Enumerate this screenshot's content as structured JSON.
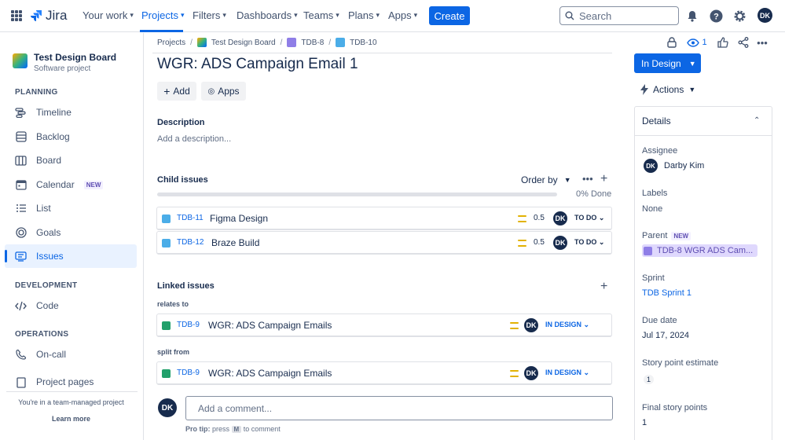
{
  "topnav": {
    "logo_text": "Jira",
    "items": [
      {
        "label": "Your work"
      },
      {
        "label": "Projects"
      },
      {
        "label": "Filters"
      },
      {
        "label": "Dashboards"
      },
      {
        "label": "Teams"
      },
      {
        "label": "Plans"
      },
      {
        "label": "Apps"
      }
    ],
    "create_label": "Create",
    "search_placeholder": "Search",
    "avatar_initials": "DK"
  },
  "sidebar": {
    "project_name": "Test Design Board",
    "project_type": "Software project",
    "planning_heading": "PLANNING",
    "planning_items": [
      {
        "label": "Timeline",
        "icon": "timeline-icon"
      },
      {
        "label": "Backlog",
        "icon": "backlog-icon"
      },
      {
        "label": "Board",
        "icon": "board-icon"
      },
      {
        "label": "Calendar",
        "icon": "calendar-icon",
        "badge": "NEW"
      },
      {
        "label": "List",
        "icon": "list-icon"
      },
      {
        "label": "Goals",
        "icon": "goals-icon"
      },
      {
        "label": "Issues",
        "icon": "issues-icon",
        "active": true
      }
    ],
    "development_heading": "DEVELOPMENT",
    "code_label": "Code",
    "operations_heading": "OPERATIONS",
    "oncall_label": "On-call",
    "project_pages_label": "Project pages",
    "team_managed_text": "You're in a team-managed project",
    "learn_more": "Learn more"
  },
  "breadcrumb": {
    "projects": "Projects",
    "project": "Test Design Board",
    "parent": "TDB-8",
    "current": "TDB-10",
    "sep": "/"
  },
  "issue": {
    "title": "WGR: ADS Campaign Email 1",
    "add_label": "Add",
    "apps_label": "Apps",
    "description_heading": "Description",
    "description_placeholder": "Add a description...",
    "child_heading": "Child issues",
    "order_by": "Order by",
    "progress_percent": 0,
    "progress_text": "0% Done",
    "children": [
      {
        "key": "TDB-11",
        "summary": "Figma Design",
        "points": "0.5",
        "assignee": "DK",
        "status": "TO DO"
      },
      {
        "key": "TDB-12",
        "summary": "Braze Build",
        "points": "0.5",
        "assignee": "DK",
        "status": "TO DO"
      }
    ],
    "linked_heading": "Linked issues",
    "links": [
      {
        "relation": "relates to",
        "key": "TDB-9",
        "summary": "WGR: ADS Campaign Emails",
        "assignee": "DK",
        "status": "IN DESIGN"
      },
      {
        "relation": "split from",
        "key": "TDB-9",
        "summary": "WGR: ADS Campaign Emails",
        "assignee": "DK",
        "status": "IN DESIGN"
      }
    ],
    "comment_avatar": "DK",
    "comment_placeholder": "Add a comment...",
    "pro_tip_prefix": "Pro tip:",
    "pro_tip_press": "press",
    "pro_tip_key": "M",
    "pro_tip_suffix": "to comment"
  },
  "right": {
    "watch_count": "1",
    "status_button": "In Design",
    "actions_label": "Actions",
    "details_heading": "Details",
    "assignee_label": "Assignee",
    "assignee_name": "Darby Kim",
    "assignee_initials": "DK",
    "labels_label": "Labels",
    "labels_value": "None",
    "parent_label": "Parent",
    "parent_badge": "NEW",
    "parent_value": "TDB-8 WGR ADS Cam...",
    "sprint_label": "Sprint",
    "sprint_value": "TDB Sprint 1",
    "due_label": "Due date",
    "due_value": "Jul 17, 2024",
    "estimate_label": "Story point estimate",
    "estimate_value": "1",
    "final_label": "Final story points",
    "final_value": "1"
  },
  "colors": {
    "brand": "#0c66e4",
    "priority_medium": "#e2b203",
    "story_green": "#22a06b",
    "subtask_blue": "#4bade8",
    "epic_purple": "#8f7ee7"
  }
}
